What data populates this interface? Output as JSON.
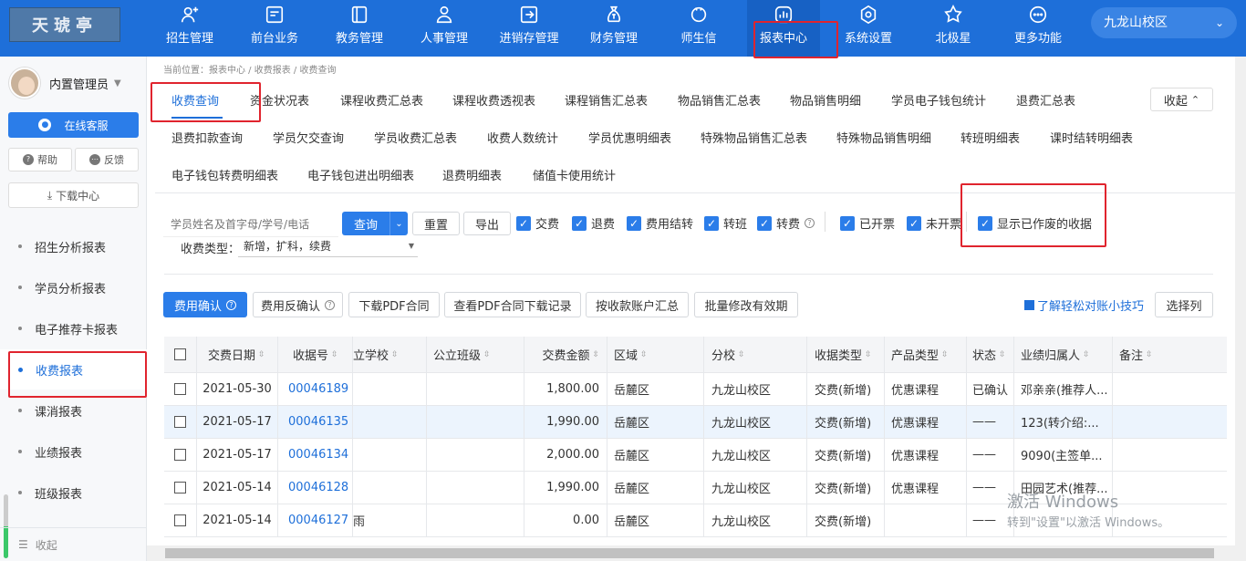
{
  "logo": {
    "text": "天琥亭"
  },
  "nav": [
    {
      "label": "招生管理",
      "icon": "user-plus-icon"
    },
    {
      "label": "前台业务",
      "icon": "monitor-icon"
    },
    {
      "label": "教务管理",
      "icon": "book-icon"
    },
    {
      "label": "人事管理",
      "icon": "person-icon"
    },
    {
      "label": "进销存管理",
      "icon": "inbox-arrow-icon"
    },
    {
      "label": "财务管理",
      "icon": "money-bag-icon"
    },
    {
      "label": "师生信",
      "icon": "chat-icon"
    },
    {
      "label": "报表中心",
      "icon": "bar-chart-icon"
    },
    {
      "label": "系统设置",
      "icon": "gear-icon"
    },
    {
      "label": "北极星",
      "icon": "star-icon"
    },
    {
      "label": "更多功能",
      "icon": "more-icon"
    }
  ],
  "campus": "九龙山校区",
  "sidebar": {
    "user": "内置管理员",
    "service": "在线客服",
    "help": "帮助",
    "feedback": "反馈",
    "download": "下载中心",
    "items": [
      "招生分析报表",
      "学员分析报表",
      "电子推荐卡报表",
      "收费报表",
      "课消报表",
      "业绩报表",
      "班级报表"
    ],
    "collapse": "收起",
    "progress": 0.5
  },
  "crumb": "当前位置：报表中心 / 收费报表 / 收费查询",
  "tabs_row1": [
    "收费查询",
    "资金状况表",
    "课程收费汇总表",
    "课程收费透视表",
    "课程销售汇总表",
    "物品销售汇总表",
    "物品销售明细",
    "学员电子钱包统计",
    "退费汇总表"
  ],
  "tabs_row2": [
    "退费扣款查询",
    "学员欠交查询",
    "学员收费汇总表",
    "收费人数统计",
    "学员优惠明细表",
    "特殊物品销售汇总表",
    "特殊物品销售明细",
    "转班明细表",
    "课时结转明细表"
  ],
  "tabs_row3": [
    "电子钱包转费明细表",
    "电子钱包进出明细表",
    "退费明细表",
    "储值卡使用统计"
  ],
  "collapse_tabs": "收起",
  "filter": {
    "search_placeholder": "学员姓名及首字母/学号/电话",
    "query": "查询",
    "reset": "重置",
    "export": "导出",
    "checks": [
      "交费",
      "退费",
      "费用结转",
      "转班",
      "转费",
      "已开票",
      "未开票",
      "显示已作废的收据"
    ],
    "type_label": "收费类型：",
    "type_value": "新增，扩科，续费"
  },
  "actions": [
    "费用确认",
    "费用反确认",
    "下载PDF合同",
    "查看PDF合同下载记录",
    "按收款账户汇总",
    "批量修改有效期"
  ],
  "tip": "了解轻松对账小技巧",
  "choose_cols": "选择列",
  "columns": [
    "交费日期",
    "收据号",
    "立学校",
    "公立班级",
    "交费金额",
    "区域",
    "分校",
    "收据类型",
    "产品类型",
    "状态",
    "业绩归属人",
    "备注"
  ],
  "rows": [
    {
      "date": "2021-05-30",
      "no": "00046189",
      "school": "",
      "cls": "",
      "amount": "1,800.00",
      "area": "岳麓区",
      "campus": "九龙山校区",
      "type": "交费(新增)",
      "product": "优惠课程",
      "status": "已确认",
      "owner": "邓亲亲(推荐人...",
      "note": ""
    },
    {
      "date": "2021-05-17",
      "no": "00046135",
      "school": "",
      "cls": "",
      "amount": "1,990.00",
      "area": "岳麓区",
      "campus": "九龙山校区",
      "type": "交费(新增)",
      "product": "优惠课程",
      "status": "——",
      "owner": "123(转介绍:...",
      "note": ""
    },
    {
      "date": "2021-05-17",
      "no": "00046134",
      "school": "",
      "cls": "",
      "amount": "2,000.00",
      "area": "岳麓区",
      "campus": "九龙山校区",
      "type": "交费(新增)",
      "product": "优惠课程",
      "status": "——",
      "owner": "9090(主签单...",
      "note": ""
    },
    {
      "date": "2021-05-14",
      "no": "00046128",
      "school": "",
      "cls": "",
      "amount": "1,990.00",
      "area": "岳麓区",
      "campus": "九龙山校区",
      "type": "交费(新增)",
      "product": "优惠课程",
      "status": "——",
      "owner": "田园艺术(推荐...",
      "note": ""
    },
    {
      "date": "2021-05-14",
      "no": "00046127",
      "school": "雨",
      "cls": "",
      "amount": "0.00",
      "area": "岳麓区",
      "campus": "九龙山校区",
      "type": "交费(新增)",
      "product": "",
      "status": "——",
      "owner": "",
      "note": ""
    }
  ],
  "watermark": {
    "line1": "激活 Windows",
    "line2": "转到\"设置\"以激活 Windows。"
  }
}
